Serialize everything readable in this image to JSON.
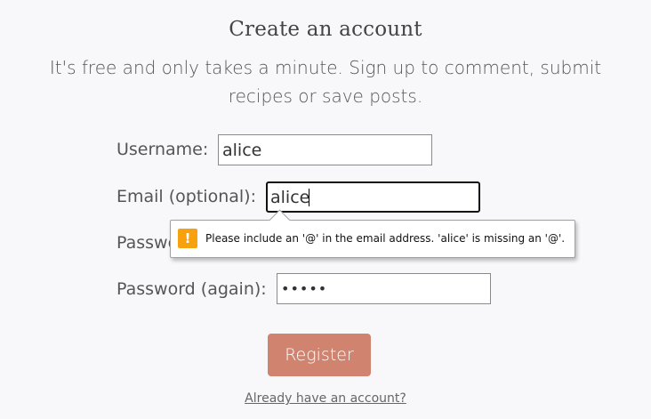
{
  "page": {
    "title": "Create an account",
    "subtitle_line1": "It's free and only takes a minute. Sign up to comment, submit",
    "subtitle_line2": "recipes or save posts."
  },
  "form": {
    "username": {
      "label": "Username:",
      "value": "alice"
    },
    "email": {
      "label": "Email (optional):",
      "value": "alice"
    },
    "password": {
      "label": "Password:",
      "value": "•••••"
    },
    "password_again": {
      "label": "Password (again):",
      "value": "•••••"
    },
    "register_label": "Register",
    "login_link": "Already have an account?"
  },
  "validation": {
    "icon": "warning-icon",
    "icon_glyph": "!",
    "message": "Please include an '@' in the email address. 'alice' is missing an '@'."
  },
  "colors": {
    "accent": "#d08470",
    "warning": "#f7a20c",
    "background": "#f8f8fa"
  }
}
